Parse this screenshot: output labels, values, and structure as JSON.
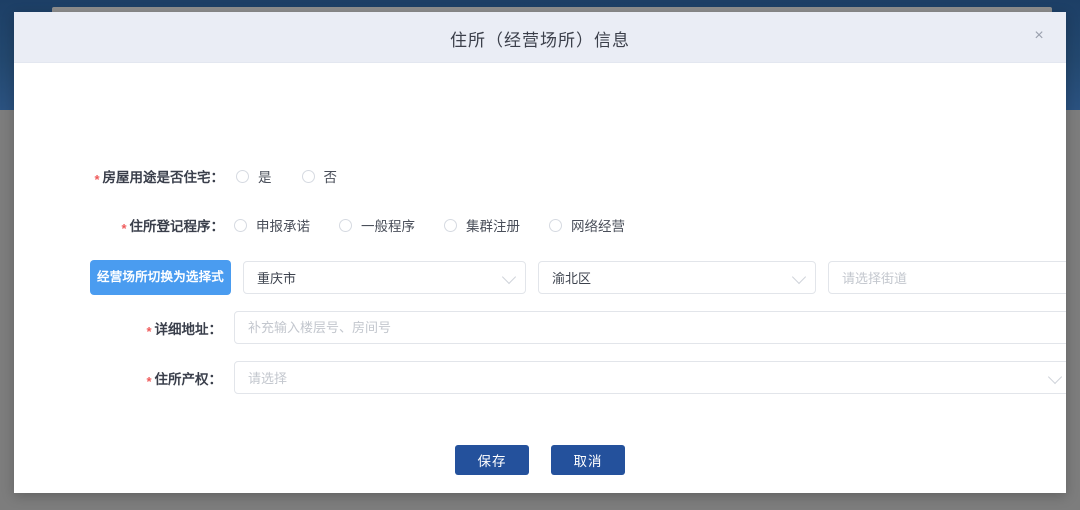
{
  "page": {
    "background_dark": "#23486f",
    "background_gray": "#7d7d7d"
  },
  "modal": {
    "title": "住所（经营场所）信息",
    "close_icon": "close-icon",
    "close_glyph": "×"
  },
  "form": {
    "house_use": {
      "label": "房屋用途是否住宅：",
      "required_marker": "*",
      "options": [
        {
          "label": "是",
          "selected": false
        },
        {
          "label": "否",
          "selected": false
        }
      ]
    },
    "registration_procedure": {
      "label": "住所登记程序：",
      "required_marker": "*",
      "options": [
        {
          "label": "申报承诺",
          "selected": false
        },
        {
          "label": "一般程序",
          "selected": false
        },
        {
          "label": "集群注册",
          "selected": false
        },
        {
          "label": "网络经营",
          "selected": false
        }
      ]
    },
    "location": {
      "switch_button_label": "经营场所切换为选择式",
      "switch_button_color": "#4a9cf0",
      "province": {
        "value": "重庆市",
        "is_placeholder": false,
        "icon": "chevron-down-icon"
      },
      "district": {
        "value": "渝北区",
        "is_placeholder": false,
        "icon": "chevron-down-icon"
      },
      "street": {
        "value": "请选择街道",
        "is_placeholder": true,
        "icon": "chevron-down-icon"
      }
    },
    "detail_address": {
      "label": "详细地址：",
      "required_marker": "*",
      "value": "",
      "placeholder": "补充输入楼层号、房间号"
    },
    "ownership": {
      "label": "住所产权：",
      "required_marker": "*",
      "value": "请选择",
      "is_placeholder": true,
      "icon": "chevron-down-icon"
    }
  },
  "footer": {
    "save_label": "保存",
    "cancel_label": "取消",
    "button_color": "#24519c"
  }
}
